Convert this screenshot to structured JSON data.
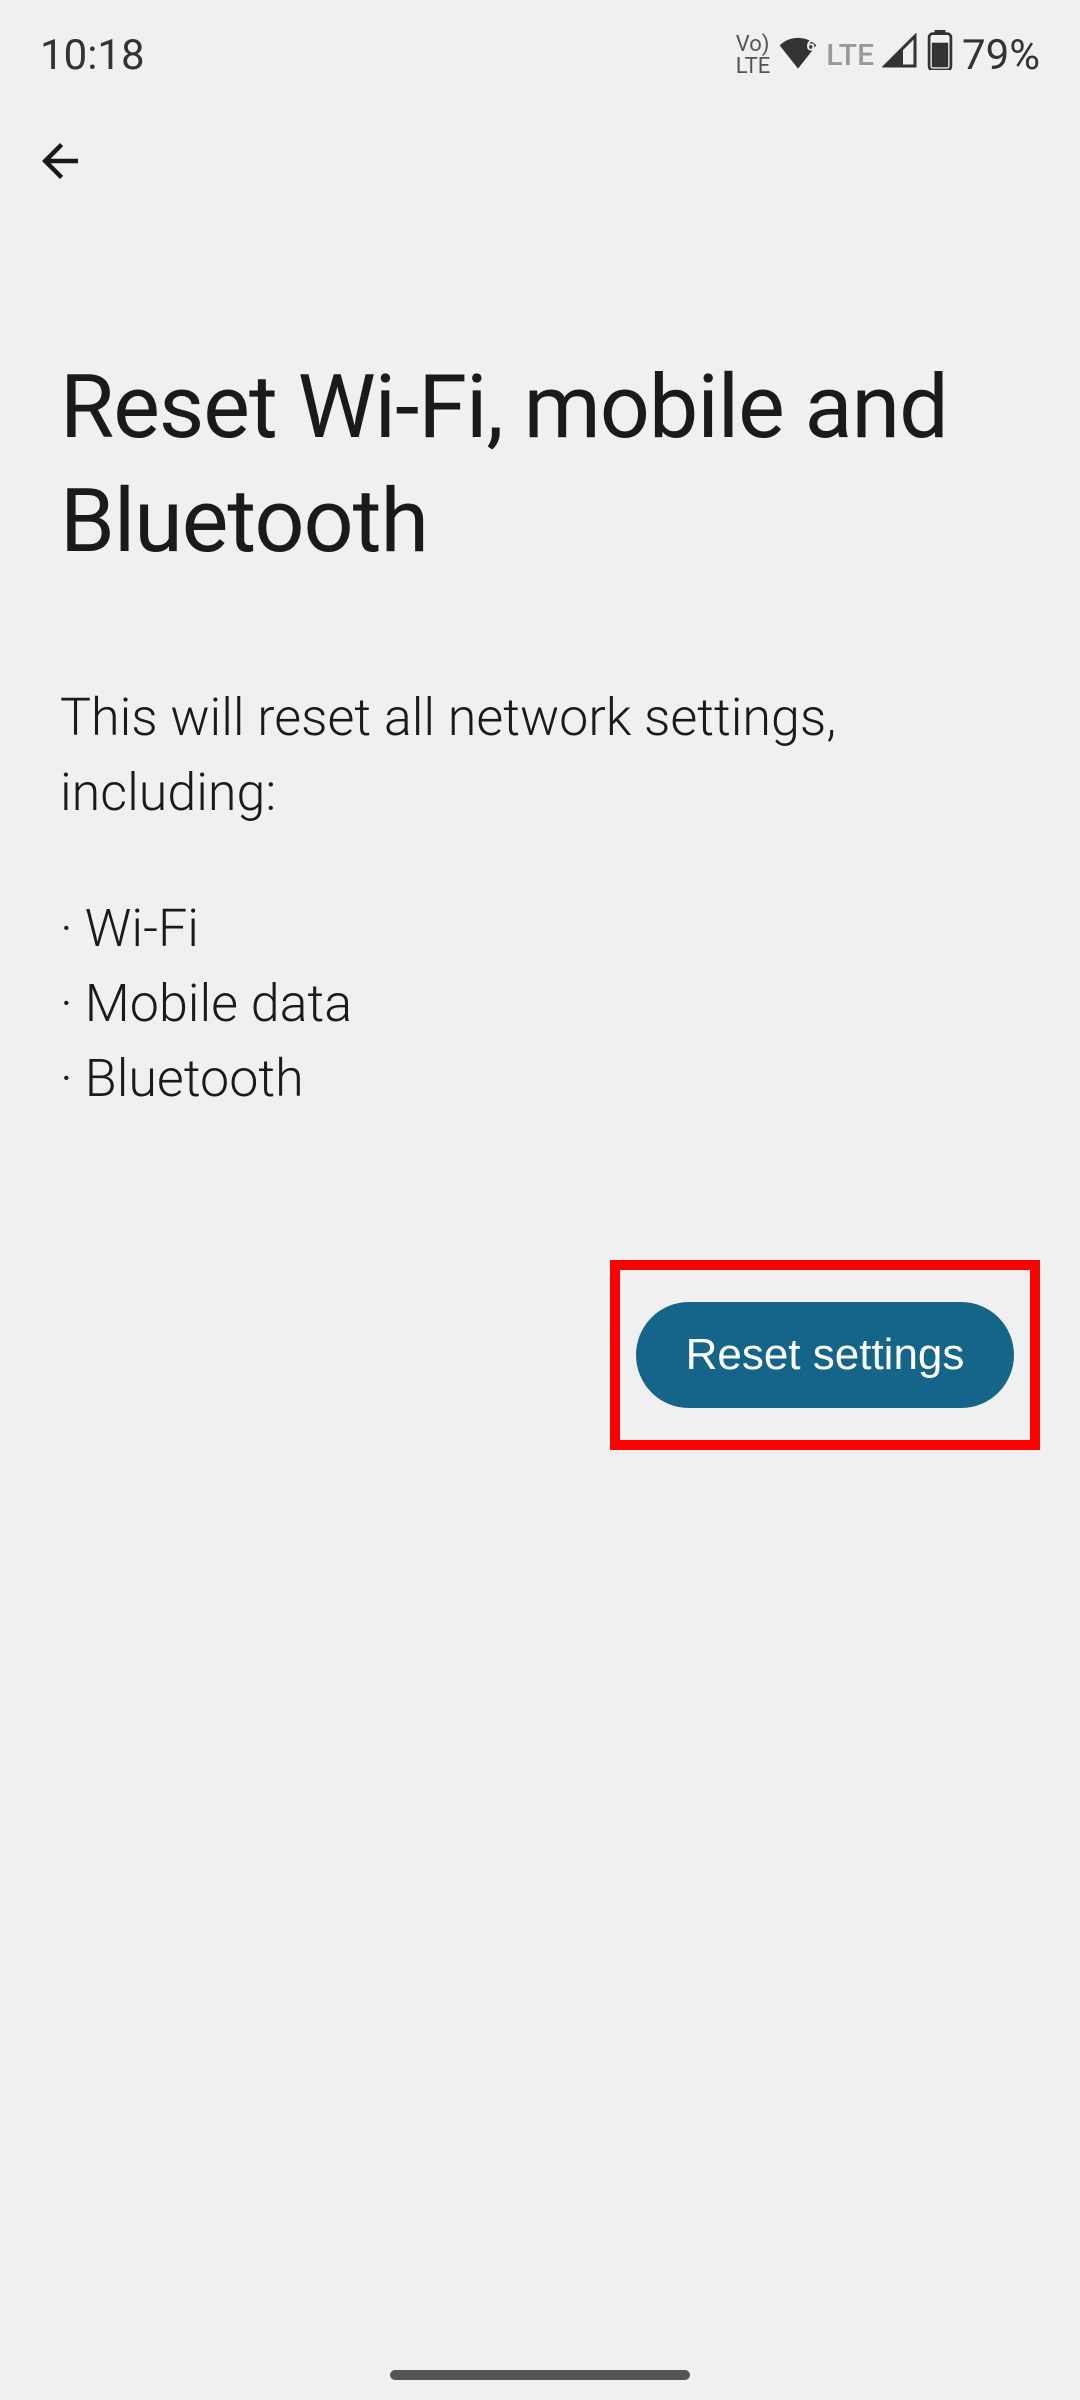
{
  "status": {
    "time": "10:18",
    "volte": "Vo\nLTE",
    "lte": "LTE",
    "battery": "79%"
  },
  "page": {
    "title": "Reset Wi-Fi, mobile and Bluetooth",
    "intro": "This will reset all network settings, including:",
    "items": [
      "Wi-Fi",
      "Mobile data",
      "Bluetooth"
    ]
  },
  "actions": {
    "reset_label": "Reset settings"
  }
}
